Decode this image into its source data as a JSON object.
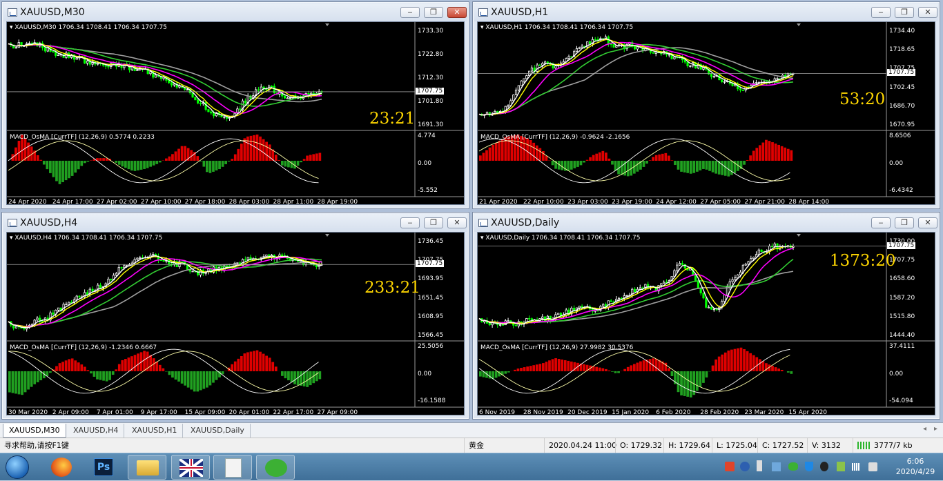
{
  "windows": [
    {
      "id": "m30",
      "title": "XAUUSD,M30",
      "info": "XAUUSD,M30  1706.34 1708.41 1706.34 1707.75",
      "price_ticks": [
        "1733.30",
        "1722.80",
        "1712.30",
        "1701.80",
        "1691.30"
      ],
      "current_price": "1707.75",
      "macd_label": "MACD_OsMA [CurrTF] (12,26,9) 0.5774 0.2233",
      "macd_ticks": [
        "4.774",
        "0.00",
        "-5.552"
      ],
      "timer": "23:21",
      "dates": [
        "24 Apr 2020",
        "24 Apr 17:00",
        "27 Apr 02:00",
        "27 Apr 10:00",
        "27 Apr 18:00",
        "28 Apr 03:00",
        "28 Apr 11:00",
        "28 Apr 19:00"
      ],
      "buttons": {
        "minimize": "‒",
        "maximize": "❐",
        "close": "✕"
      }
    },
    {
      "id": "h1",
      "title": "XAUUSD,H1",
      "info": "XAUUSD,H1  1706.34 1708.41 1706.34 1707.75",
      "price_ticks": [
        "1734.40",
        "1718.65",
        "1707.75",
        "1702.45",
        "1686.70",
        "1670.95"
      ],
      "current_price": "1707.75",
      "macd_label": "MACD_OsMA [CurrTF] (12,26,9) -0.9624 -2.1656",
      "macd_ticks": [
        "8.6506",
        "0.00",
        "-6.4342"
      ],
      "timer": "53:20",
      "dates": [
        "21 Apr 2020",
        "22 Apr 10:00",
        "23 Apr 03:00",
        "23 Apr 19:00",
        "24 Apr 12:00",
        "27 Apr 05:00",
        "27 Apr 21:00",
        "28 Apr 14:00"
      ],
      "buttons": {
        "minimize": "‒",
        "maximize": "❐",
        "close": "✕"
      }
    },
    {
      "id": "h4",
      "title": "XAUUSD,H4",
      "info": "XAUUSD,H4  1706.34 1708.41 1706.34 1707.75",
      "price_ticks": [
        "1736.45",
        "1707.75",
        "1693.95",
        "1651.45",
        "1608.95",
        "1566.45"
      ],
      "current_price": "1707.75",
      "macd_label": "MACD_OsMA [CurrTF] (12,26,9) -1.2346 0.6667",
      "macd_ticks": [
        "25.5056",
        "0.00",
        "-16.1588"
      ],
      "timer": "233:21",
      "dates": [
        "30 Mar 2020",
        "2 Apr 09:00",
        "7 Apr 01:00",
        "9 Apr 17:00",
        "15 Apr 09:00",
        "20 Apr 01:00",
        "22 Apr 17:00",
        "27 Apr 09:00"
      ],
      "buttons": {
        "minimize": "‒",
        "maximize": "❐",
        "close": "✕"
      }
    },
    {
      "id": "d1",
      "title": "XAUUSD,Daily",
      "info": "XAUUSD,Daily  1706.34 1708.41 1706.34 1707.75",
      "price_ticks": [
        "1730.00",
        "1707.75",
        "1658.60",
        "1587.20",
        "1515.80",
        "1444.40"
      ],
      "current_price": "1707.75",
      "macd_label": "MACD_OsMA [CurrTF] (12,26,9) 27.9982 30.5376",
      "macd_ticks": [
        "37.4111",
        "0.00",
        "-54.094"
      ],
      "timer": "1373:20",
      "dates": [
        "6 Nov 2019",
        "28 Nov 2019",
        "20 Dec 2019",
        "15 Jan 2020",
        "6 Feb 2020",
        "28 Feb 2020",
        "23 Mar 2020",
        "15 Apr 2020"
      ],
      "buttons": {
        "minimize": "‒",
        "maximize": "❐",
        "close": "✕"
      }
    }
  ],
  "tabs": [
    "XAUUSD,M30",
    "XAUUSD,H4",
    "XAUUSD,H1",
    "XAUUSD,Daily"
  ],
  "status": {
    "help": "寻求帮助,请按F1键",
    "symbol": "黄金",
    "datetime": "2020.04.24 11:00",
    "open": "O: 1729.32",
    "high": "H: 1729.64",
    "low": "L: 1725.04",
    "close": "C: 1727.52",
    "volume": "V: 3132",
    "traffic": "3777/7 kb"
  },
  "taskbar": {
    "time": "6:06",
    "date": "2020/4/29",
    "ps_label": "Ps"
  },
  "colors": {
    "bull": "#ffffff",
    "bear": "#00ff00",
    "ma_fast": "#ffffff",
    "ma_yellow": "#ffff00",
    "ma_magenta": "#ff00ff",
    "ma_green": "#32cd32",
    "ma_gray": "#a0a0a0",
    "osma_pos": "#e00000",
    "osma_neg": "#20a020",
    "timer": "#ffd700"
  }
}
